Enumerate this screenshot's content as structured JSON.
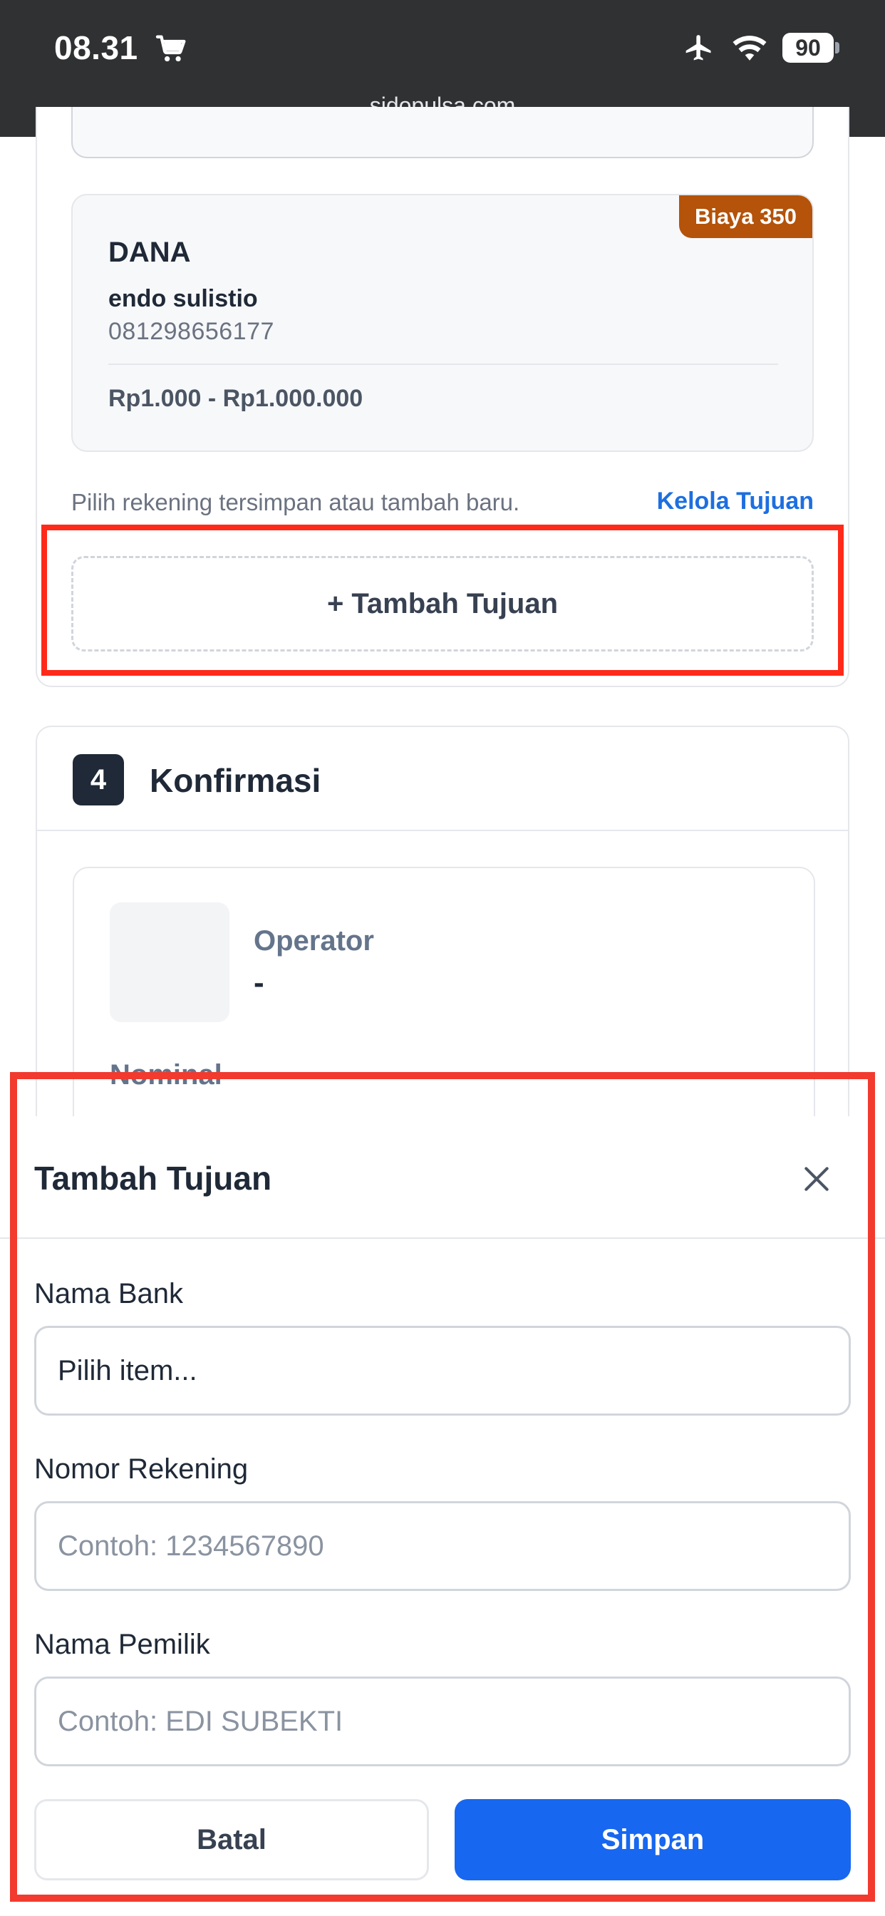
{
  "status_bar": {
    "time": "08.31",
    "battery": "90",
    "url": "sidopulsa.com",
    "icons": [
      "cart-icon",
      "airplane-icon",
      "wifi-icon",
      "battery-icon"
    ]
  },
  "destination_card": {
    "fee_badge": "Biaya 350",
    "provider": "DANA",
    "holder_name": "endo sulistio",
    "account_number": "081298656177",
    "range": "Rp1.000 - Rp1.000.000"
  },
  "destination_section": {
    "hint": "Pilih rekening tersimpan atau tambah baru.",
    "manage_link": "Kelola Tujuan",
    "add_button": "+ Tambah Tujuan"
  },
  "confirm_section": {
    "step_number": "4",
    "title": "Konfirmasi",
    "operator_label": "Operator",
    "operator_value": "-",
    "nominal_label": "Nominal"
  },
  "modal": {
    "title": "Tambah Tujuan",
    "bank_label": "Nama Bank",
    "bank_value": "Pilih item...",
    "account_label": "Nomor Rekening",
    "account_placeholder": "Contoh: 1234567890",
    "owner_label": "Nama Pemilik",
    "owner_placeholder": "Contoh: EDI SUBEKTI",
    "cancel_label": "Batal",
    "save_label": "Simpan"
  },
  "colors": {
    "highlight_border": "#ff2a1a",
    "fee_badge": "#b45309",
    "link": "#1d6fe0",
    "primary_button": "#1767f0",
    "status_bar_bg": "#2f3133"
  }
}
